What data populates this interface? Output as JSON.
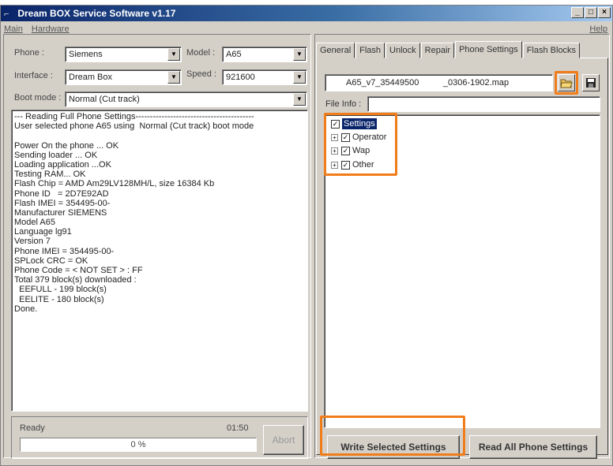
{
  "caption_fragment": "Dream BOX software — phone settings panel",
  "window": {
    "title": "Dream BOX Service Software v1.17",
    "buttons": [
      "_",
      "□",
      "×"
    ]
  },
  "menu": {
    "items": [
      "Main",
      "Hardware"
    ],
    "help": "Help"
  },
  "phone": {
    "label": "Phone :",
    "value": "Siemens"
  },
  "model": {
    "label": "Model :",
    "value": "A65"
  },
  "interface": {
    "label": "Interface :",
    "value": "Dream Box"
  },
  "speed": {
    "label": "Speed :",
    "value": "921600"
  },
  "bootmode": {
    "label": "Boot mode :",
    "value": "Normal (Cut track)"
  },
  "log": {
    "lines": [
      "--- Reading Full Phone Settings-----------------------------------------",
      "User selected phone A65 using  Normal (Cut track) boot mode",
      "",
      "Power On the phone ... OK",
      "Sending loader ... OK",
      "Loading application ...OK",
      "Testing RAM... OK",
      "Flash Chip = AMD Am29LV128MH/L, size 16384 Kb",
      "Phone ID   = 2D7E92AD",
      "Flash IMEI = 354495-00-",
      "Manufacturer SIEMENS",
      "Model A65",
      "Language lg91",
      "Version 7",
      "Phone IMEI = 354495-00-",
      "SPLock CRC = OK",
      "Phone Code = < NOT SET > : FF",
      "Total 379 block(s) downloaded :",
      "  EEFULL - 199 block(s)",
      "  EELITE - 180 block(s)",
      "Done."
    ]
  },
  "status": {
    "text": "Ready",
    "time": "01:50",
    "progress_text": "0 %",
    "progress": 0,
    "abort": "Abort"
  },
  "tabs": [
    "General",
    "Flash",
    "Unlock",
    "Repair",
    "Phone Settings",
    "Flash Blocks"
  ],
  "active_tab": "Phone Settings",
  "map_file": "A65_v7_35449500          _0306-1902.map",
  "file_info_label": "File Info :",
  "tree": {
    "root": "Settings",
    "children": [
      "Operator",
      "Wap",
      "Other"
    ]
  },
  "buttons": {
    "write": "Write Selected Settings",
    "read": "Read All Phone Settings"
  },
  "colors": {
    "highlight": "#f07c1a",
    "title_gradient_start": "#0a246a",
    "selection": "#0a246a"
  },
  "icons": {
    "open": "folder-open-icon",
    "save": "floppy-save-icon"
  }
}
